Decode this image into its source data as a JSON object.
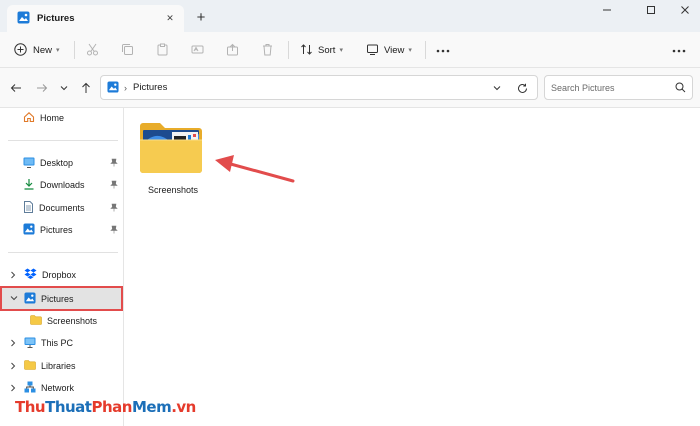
{
  "window": {
    "tab_title": "Pictures",
    "new_tab_symbol": "+",
    "close_tab_symbol": "✕"
  },
  "toolbar": {
    "new_label": "New",
    "sort_label": "Sort",
    "view_label": "View"
  },
  "address": {
    "crumbs": [
      "Pictures"
    ],
    "search_placeholder": "Search Pictures"
  },
  "sidebar": {
    "home": "Home",
    "quick_access": [
      {
        "label": "Desktop",
        "icon": "desktop-icon"
      },
      {
        "label": "Downloads",
        "icon": "download-icon"
      },
      {
        "label": "Documents",
        "icon": "document-icon"
      },
      {
        "label": "Pictures",
        "icon": "pictures-icon"
      }
    ],
    "tree": [
      {
        "label": "Dropbox",
        "icon": "dropbox-icon",
        "expanded": false
      },
      {
        "label": "Pictures",
        "icon": "pictures-icon",
        "expanded": true,
        "selected": true
      },
      {
        "label": "Screenshots",
        "icon": "folder-icon",
        "child": true
      },
      {
        "label": "This PC",
        "icon": "pc-icon",
        "expanded": false
      },
      {
        "label": "Libraries",
        "icon": "libraries-icon",
        "expanded": false
      },
      {
        "label": "Network",
        "icon": "network-icon",
        "expanded": false
      }
    ]
  },
  "content": {
    "items": [
      {
        "name": "Screenshots",
        "type": "folder"
      }
    ]
  },
  "colors": {
    "accent": "#0067c0",
    "selection_outline": "#e24c4c",
    "annotation_arrow": "#e24c4c",
    "folder_yellow": "#f5c946"
  },
  "watermark": {
    "part1": "Thu",
    "part2": "Thuat",
    "part3": "Phan",
    "part4": "Mem",
    "part5": ".vn"
  }
}
